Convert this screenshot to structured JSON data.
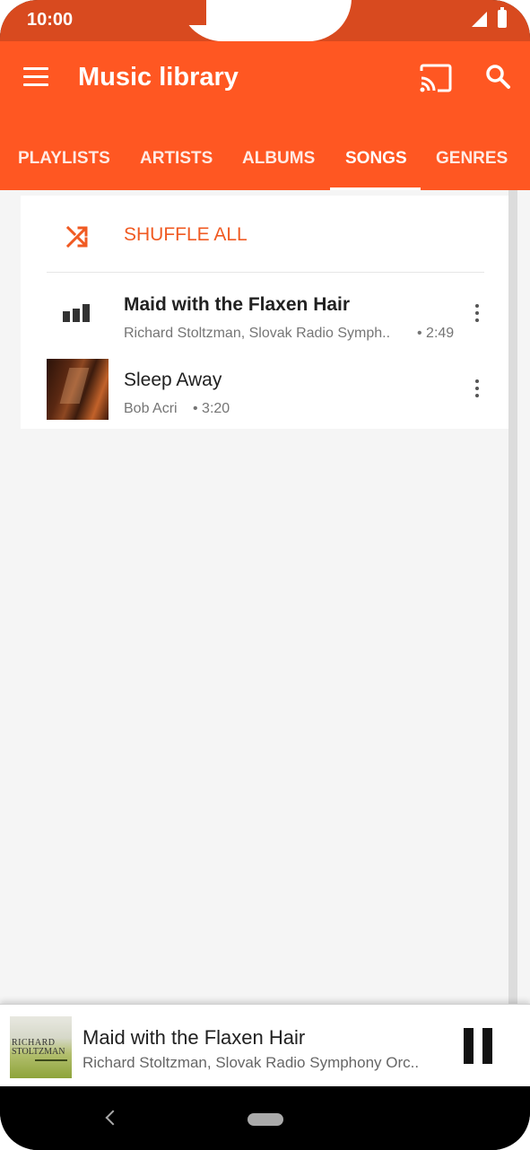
{
  "status_bar": {
    "time": "10:00"
  },
  "app_bar": {
    "title": "Music library",
    "icons": {
      "menu": "menu-icon",
      "cast": "cast-icon",
      "search": "search-icon"
    }
  },
  "tabs": [
    {
      "label": "PLAYLISTS",
      "active": false
    },
    {
      "label": "ARTISTS",
      "active": false
    },
    {
      "label": "ALBUMS",
      "active": false
    },
    {
      "label": "SONGS",
      "active": true
    },
    {
      "label": "GENRES",
      "active": false
    }
  ],
  "shuffle": {
    "label": "SHUFFLE ALL"
  },
  "songs": [
    {
      "title": "Maid with the Flaxen Hair",
      "artist": "Richard Stoltzman, Slovak Radio Symph..",
      "duration": "• 2:49",
      "playing": true
    },
    {
      "title": "Sleep Away",
      "artist": "Bob Acri",
      "duration": "• 3:20",
      "playing": false
    }
  ],
  "mini_player": {
    "title": "Maid with the Flaxen Hair",
    "subtitle": "Richard Stoltzman, Slovak Radio Symphony Orc..",
    "art_text": [
      "RICHARD",
      "STOLTZMAN"
    ]
  },
  "colors": {
    "accent": "#ff5722",
    "status_bar": "#d84a1f",
    "shuffle": "#f05a22"
  }
}
